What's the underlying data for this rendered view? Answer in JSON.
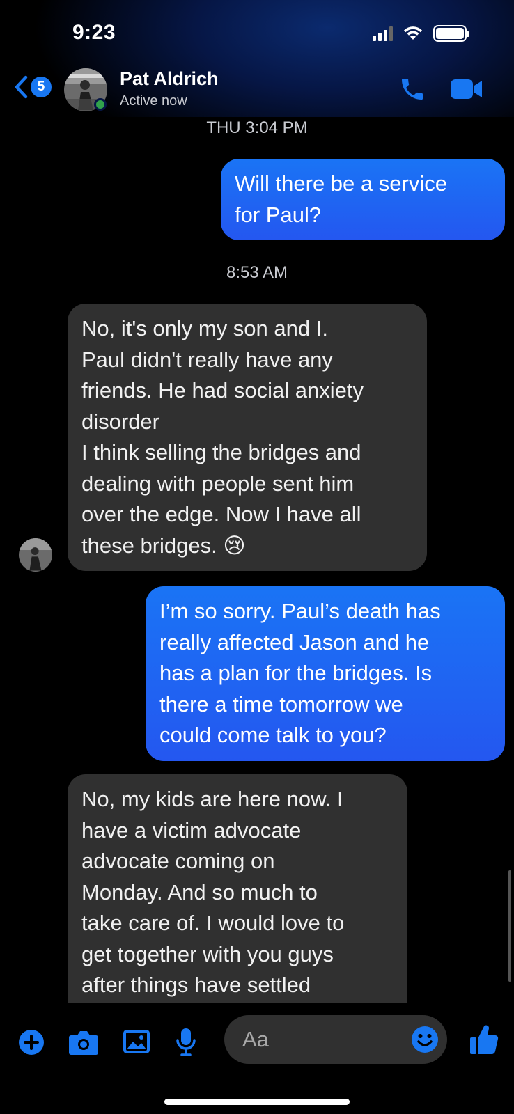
{
  "status_bar": {
    "time": "9:23"
  },
  "header": {
    "back_badge": "5",
    "contact_name": "Pat Aldrich",
    "status": "Active now",
    "icons": [
      "back-chevron-icon",
      "phone-icon",
      "video-camera-icon"
    ]
  },
  "messages": {
    "ts1": "THU 3:04 PM",
    "m1": [
      "Will there be a service",
      "for Paul?"
    ],
    "ts2": "8:53 AM",
    "m2": [
      "No,  it's only my son and I.",
      "Paul didn't really have any",
      "friends. He had social anxiety",
      "disorder",
      "I think selling the bridges and",
      "dealing with people sent him",
      "over the edge. Now I have all",
      "these bridges. 😢"
    ],
    "m3": [
      "I’m so sorry. Paul’s death has",
      "really affected Jason and he",
      "has a plan for the bridges. Is",
      "there a time tomorrow we",
      "could come talk to you?"
    ],
    "m4": [
      "No,  my kids are here now. I",
      "have a victim advocate",
      "advocate coming on",
      "Monday. And so much to",
      "take care of. I would love to",
      "get together with you guys",
      "after things have settled"
    ]
  },
  "composer": {
    "placeholder": "Aa",
    "tools": [
      "plus-icon",
      "camera-icon",
      "gallery-icon",
      "microphone-icon",
      "emoji-icon",
      "thumbs-up-icon"
    ]
  },
  "colors": {
    "accent": "#1877f2",
    "bubble_out": "#2457f0",
    "bubble_in": "#303030",
    "online": "#31a24c"
  }
}
